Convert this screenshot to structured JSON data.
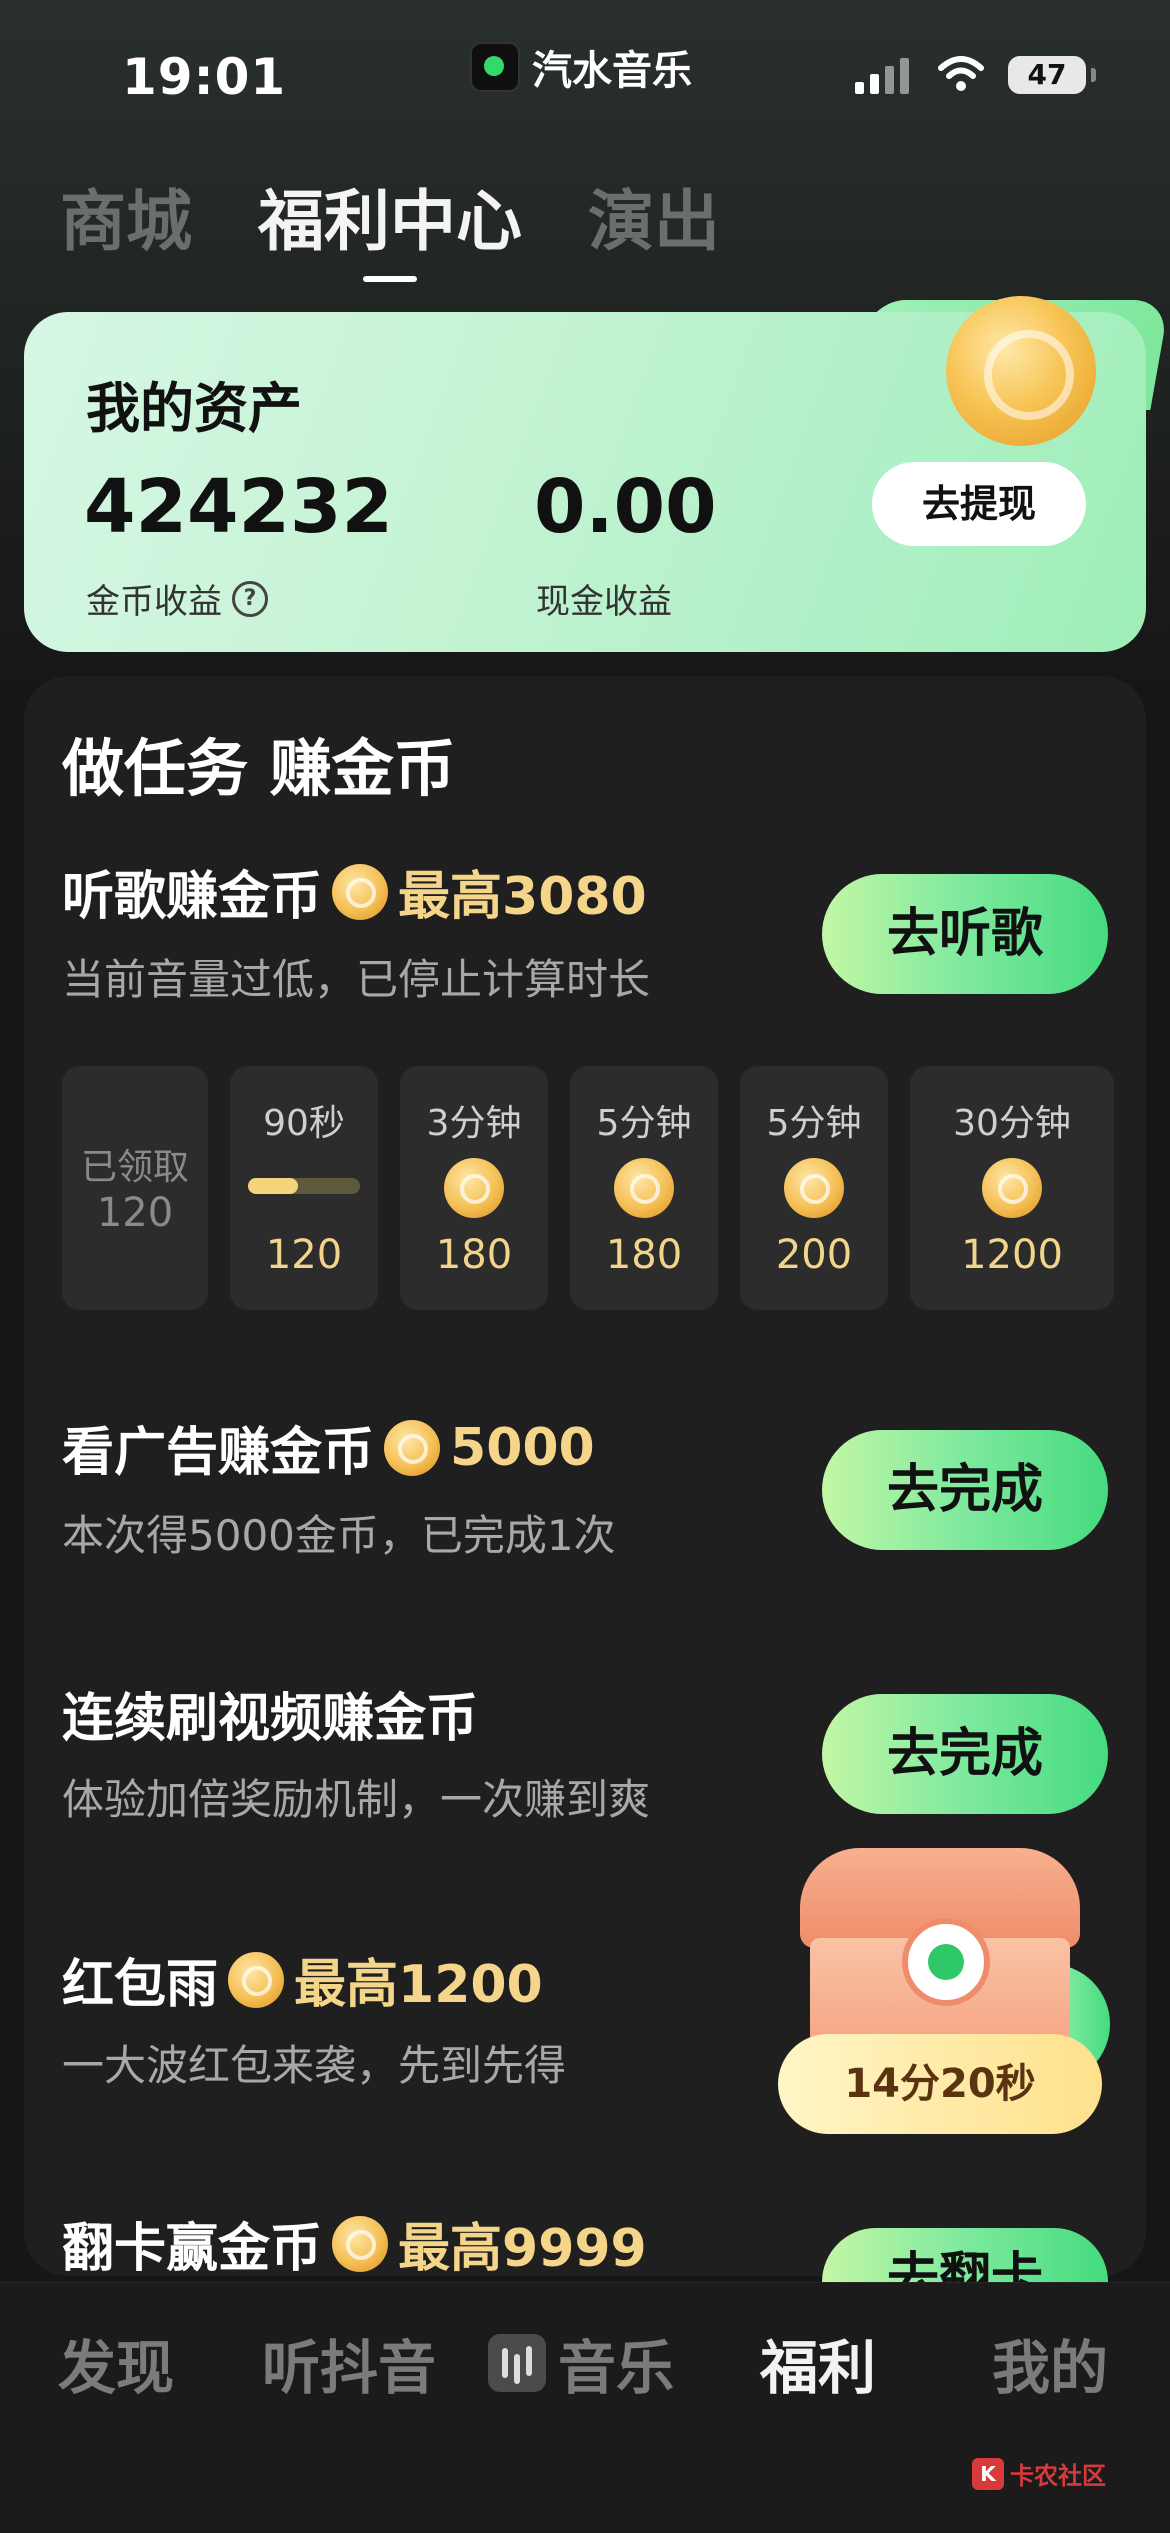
{
  "status_bar": {
    "time": "19:01",
    "app_name": "汽水音乐",
    "battery": "47"
  },
  "top_tabs": [
    {
      "label": "商城",
      "active": false
    },
    {
      "label": "福利中心",
      "active": true
    },
    {
      "label": "演出",
      "active": false
    }
  ],
  "assets": {
    "title": "我的资产",
    "coin_value": "424232",
    "coin_label": "金币收益",
    "cash_value": "0.00",
    "cash_label": "现金收益",
    "withdraw_button": "去提现"
  },
  "tasks": {
    "title": "做任务 赚金币",
    "listen": {
      "title": "听歌赚金币",
      "reward": "最高3080",
      "subtitle": "当前音量过低，已停止计算时长",
      "button": "去听歌",
      "milestones": [
        {
          "label": "已领取",
          "value": "120",
          "claimed": true
        },
        {
          "label": "90秒",
          "value": "120",
          "progress": 0.45
        },
        {
          "label": "3分钟",
          "value": "180"
        },
        {
          "label": "5分钟",
          "value": "180"
        },
        {
          "label": "5分钟",
          "value": "200"
        },
        {
          "label": "30分钟",
          "value": "1200"
        }
      ]
    },
    "ad": {
      "title": "看广告赚金币",
      "reward": "5000",
      "subtitle": "本次得5000金币，已完成1次",
      "button": "去完成"
    },
    "video": {
      "title": "连续刷视频赚金币",
      "subtitle": "体验加倍奖励机制，一次赚到爽",
      "button": "去完成"
    },
    "redpack": {
      "title": "红包雨",
      "reward": "最高1200",
      "subtitle": "一大波红包来袭，先到先得"
    },
    "flip": {
      "title": "翻卡赢金币",
      "reward": "最高9999",
      "button": "去翻卡"
    }
  },
  "treasure": {
    "timer": "14分20秒"
  },
  "bottom_nav": [
    {
      "label": "发现",
      "active": false
    },
    {
      "label": "听抖音",
      "active": false
    },
    {
      "label": "音乐",
      "active": false
    },
    {
      "label": "福利",
      "active": true
    },
    {
      "label": "我的",
      "active": false
    }
  ],
  "watermark": "卡农社区",
  "colors": {
    "accent_green": "#45db7f",
    "gold": "#f5d58a",
    "background": "#161616"
  }
}
